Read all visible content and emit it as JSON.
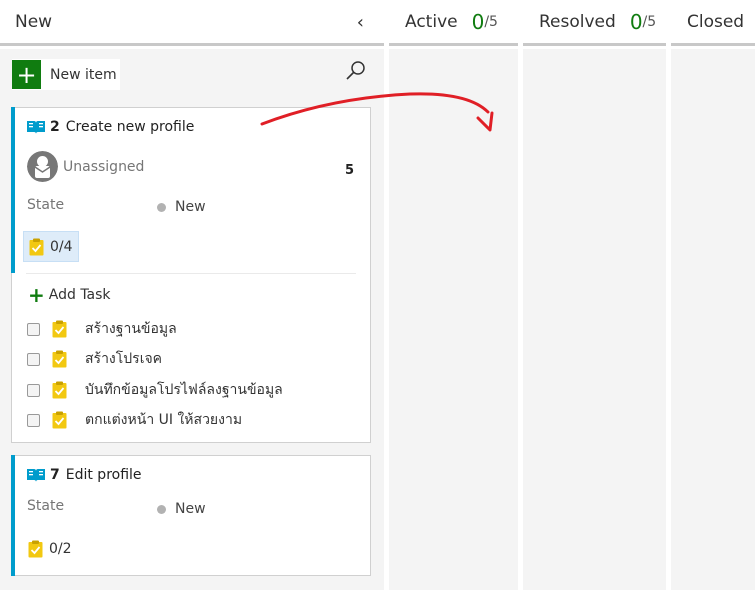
{
  "columns": [
    {
      "title": "New"
    },
    {
      "title": "Active",
      "count": "0",
      "limit": "/5"
    },
    {
      "title": "Resolved",
      "count": "0",
      "limit": "/5"
    },
    {
      "title": "Closed"
    }
  ],
  "toolbar": {
    "collapse_glyph": "‹",
    "new_item_label": "New item",
    "new_item_plus": "+"
  },
  "cards": [
    {
      "id": "2",
      "title": "Create new profile",
      "assignee": "Unassigned",
      "effort": "5",
      "state_label": "State",
      "state": "New",
      "tasks_progress": "0/4",
      "add_task_label": "Add Task",
      "add_task_plus": "+",
      "tasks": [
        {
          "title": "สร้างฐานข้อมูล"
        },
        {
          "title": "สร้างโปรเจค"
        },
        {
          "title": "บันทึกข้อมูลโปรไฟล์ลงฐานข้อมูล"
        },
        {
          "title": "ตกแต่งหน้า UI ให้สวยงาม"
        }
      ]
    },
    {
      "id": "7",
      "title": "Edit profile",
      "state_label": "State",
      "state": "New",
      "tasks_progress": "0/2"
    }
  ],
  "colors": {
    "accent_blue": "#009ccc",
    "count_green": "#107c10",
    "annotation_arrow": "#e01f26",
    "column_background": "#f4f4f4"
  },
  "icons": [
    "collapse-chevron-icon",
    "add-icon",
    "search-icon",
    "backlog-book-icon",
    "avatar-icon",
    "state-dot-icon",
    "task-clipboard-icon",
    "checkbox-icon",
    "annotation-arrow"
  ]
}
